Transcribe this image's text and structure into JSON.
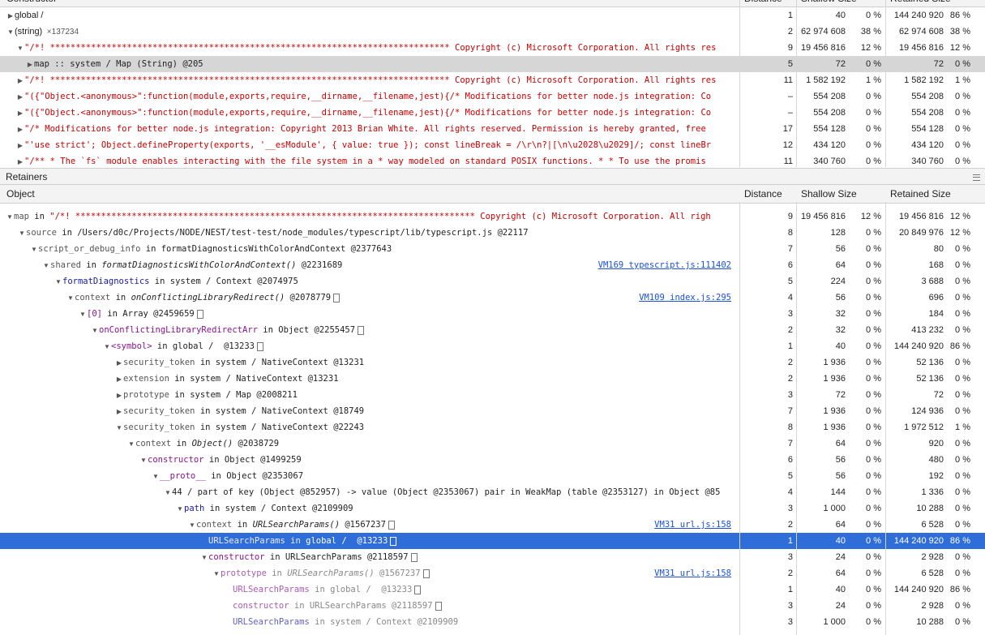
{
  "top_header": {
    "constructor": "Constructor",
    "distance": "Distance",
    "shallow": "Shallow Size",
    "retained": "Retained Size"
  },
  "top_rows": [
    {
      "indent": 0,
      "tri": "▶",
      "parts": [
        {
          "t": "global /",
          "c": ""
        }
      ],
      "dist": "1",
      "shv": "40",
      "shp": "0 %",
      "rtv": "144 240 920",
      "rtp": "86 %"
    },
    {
      "indent": 0,
      "tri": "▼",
      "parts": [
        {
          "t": "(string)",
          "c": ""
        },
        {
          "t": "  ×137234",
          "c": "grey small"
        }
      ],
      "dist": "2",
      "shv": "62 974 608",
      "shp": "38 %",
      "rtv": "62 974 608",
      "rtp": "38 %"
    },
    {
      "indent": 1,
      "tri": "▼",
      "parts": [
        {
          "t": "\"/*! ****************************************************************************** Copyright (c) Microsoft Corporation. All rights res",
          "c": "red mono"
        }
      ],
      "dist": "9",
      "shv": "19 456 816",
      "shp": "12 %",
      "rtv": "19 456 816",
      "rtp": "12 %"
    },
    {
      "indent": 2,
      "tri": "▶",
      "parts": [
        {
          "t": "map :: system / Map (String) @205",
          "c": "mono"
        }
      ],
      "dist": "5",
      "shv": "72",
      "shp": "0 %",
      "rtv": "72",
      "rtp": "0 %",
      "sel": "grey"
    },
    {
      "indent": 1,
      "tri": "▶",
      "parts": [
        {
          "t": "\"/*! ****************************************************************************** Copyright (c) Microsoft Corporation. All rights res",
          "c": "red mono"
        }
      ],
      "dist": "11",
      "shv": "1 582 192",
      "shp": "1 %",
      "rtv": "1 582 192",
      "rtp": "1 %"
    },
    {
      "indent": 1,
      "tri": "▶",
      "parts": [
        {
          "t": "\"({\"Object.<anonymous>\":function(module,exports,require,__dirname,__filename,jest){/* Modifications for better node.js integration: Co",
          "c": "red mono"
        }
      ],
      "dist": "–",
      "shv": "554 208",
      "shp": "0 %",
      "rtv": "554 208",
      "rtp": "0 %"
    },
    {
      "indent": 1,
      "tri": "▶",
      "parts": [
        {
          "t": "\"({\"Object.<anonymous>\":function(module,exports,require,__dirname,__filename,jest){/* Modifications for better node.js integration: Co",
          "c": "red mono"
        }
      ],
      "dist": "–",
      "shv": "554 208",
      "shp": "0 %",
      "rtv": "554 208",
      "rtp": "0 %"
    },
    {
      "indent": 1,
      "tri": "▶",
      "parts": [
        {
          "t": "\"/* Modifications for better node.js integration: Copyright 2013 Brian White. All rights reserved. Permission is hereby granted, free",
          "c": "red mono"
        }
      ],
      "dist": "17",
      "shv": "554 128",
      "shp": "0 %",
      "rtv": "554 128",
      "rtp": "0 %"
    },
    {
      "indent": 1,
      "tri": "▶",
      "parts": [
        {
          "t": "\"'use strict'; Object.defineProperty(exports, '__esModule', { value: true }); const lineBreak = /\\r\\n?|[\\n\\u2028\\u2029]/; const lineBr",
          "c": "red mono"
        }
      ],
      "dist": "12",
      "shv": "434 120",
      "shp": "0 %",
      "rtv": "434 120",
      "rtp": "0 %"
    },
    {
      "indent": 1,
      "tri": "▶",
      "parts": [
        {
          "t": "\"/** * The `fs` module enables interacting with the file system in a * way modeled on standard POSIX functions. * * To use the promis",
          "c": "red mono"
        }
      ],
      "dist": "11",
      "shv": "340 760",
      "shp": "0 %",
      "rtv": "340 760",
      "rtp": "0 %"
    }
  ],
  "retainers_title": "Retainers",
  "bottom_header": {
    "object": "Object",
    "distance": "Distance",
    "shallow": "Shallow Size",
    "retained": "Retained Size"
  },
  "bottom_rows": [
    {
      "indent": 0,
      "tri": "▼",
      "parts": [
        {
          "t": "map",
          "c": "grey mono"
        },
        {
          "t": " in ",
          "c": "mono"
        },
        {
          "t": "\"/*! ****************************************************************************** Copyright (c) Microsoft Corporation. All righ",
          "c": "red mono"
        }
      ],
      "dist": "9",
      "shv": "19 456 816",
      "shp": "12 %",
      "rtv": "19 456 816",
      "rtp": "12 %"
    },
    {
      "indent": 1,
      "tri": "▼",
      "parts": [
        {
          "t": "source",
          "c": "grey mono"
        },
        {
          "t": " in /Users/d0c/Projects/NODE/NEST/test-test/node_modules/typescript/lib/typescript.js @22117",
          "c": "mono"
        }
      ],
      "dist": "8",
      "shv": "128",
      "shp": "0 %",
      "rtv": "20 849 976",
      "rtp": "12 %"
    },
    {
      "indent": 2,
      "tri": "▼",
      "parts": [
        {
          "t": "script_or_debug_info",
          "c": "grey mono"
        },
        {
          "t": " in formatDiagnosticsWithColorAndContext @2377643",
          "c": "mono"
        }
      ],
      "dist": "7",
      "shv": "56",
      "shp": "0 %",
      "rtv": "80",
      "rtp": "0 %"
    },
    {
      "indent": 3,
      "tri": "▼",
      "parts": [
        {
          "t": "shared",
          "c": "grey mono"
        },
        {
          "t": " in ",
          "c": "mono"
        },
        {
          "t": "formatDiagnosticsWithColorAndContext()",
          "c": "mono italic"
        },
        {
          "t": " @2231689",
          "c": "mono"
        }
      ],
      "link": "VM169 typescript.js:111402",
      "dist": "6",
      "shv": "64",
      "shp": "0 %",
      "rtv": "168",
      "rtp": "0 %"
    },
    {
      "indent": 4,
      "tri": "▼",
      "parts": [
        {
          "t": "formatDiagnostics",
          "c": "blue mono"
        },
        {
          "t": " in system / Context @2074975",
          "c": "mono"
        }
      ],
      "dist": "5",
      "shv": "224",
      "shp": "0 %",
      "rtv": "3 688",
      "rtp": "0 %"
    },
    {
      "indent": 5,
      "tri": "▼",
      "parts": [
        {
          "t": "context",
          "c": "grey mono"
        },
        {
          "t": " in ",
          "c": "mono"
        },
        {
          "t": "onConflictingLibraryRedirect()",
          "c": "mono italic"
        },
        {
          "t": " @2078779",
          "c": "mono"
        }
      ],
      "box": true,
      "link": "VM109 index.js:295",
      "dist": "4",
      "shv": "56",
      "shp": "0 %",
      "rtv": "696",
      "rtp": "0 %"
    },
    {
      "indent": 6,
      "tri": "▼",
      "parts": [
        {
          "t": "[0]",
          "c": "purple mono"
        },
        {
          "t": " in Array @2459659",
          "c": "mono"
        }
      ],
      "box": true,
      "dist": "3",
      "shv": "32",
      "shp": "0 %",
      "rtv": "184",
      "rtp": "0 %"
    },
    {
      "indent": 7,
      "tri": "▼",
      "parts": [
        {
          "t": "onConflictingLibraryRedirectArr",
          "c": "purple mono"
        },
        {
          "t": " in Object @2255457",
          "c": "mono"
        }
      ],
      "box": true,
      "dist": "2",
      "shv": "32",
      "shp": "0 %",
      "rtv": "413 232",
      "rtp": "0 %"
    },
    {
      "indent": 8,
      "tri": "▼",
      "parts": [
        {
          "t": "<symbol>",
          "c": "purple mono"
        },
        {
          "t": " in global /  @13233",
          "c": "mono"
        }
      ],
      "box": true,
      "dist": "1",
      "shv": "40",
      "shp": "0 %",
      "rtv": "144 240 920",
      "rtp": "86 %"
    },
    {
      "indent": 9,
      "tri": "▶",
      "parts": [
        {
          "t": "security_token",
          "c": "grey mono"
        },
        {
          "t": " in system / NativeContext @13231",
          "c": "mono"
        }
      ],
      "dist": "2",
      "shv": "1 936",
      "shp": "0 %",
      "rtv": "52 136",
      "rtp": "0 %"
    },
    {
      "indent": 9,
      "tri": "▶",
      "parts": [
        {
          "t": "extension",
          "c": "grey mono"
        },
        {
          "t": " in system / NativeContext @13231",
          "c": "mono"
        }
      ],
      "dist": "2",
      "shv": "1 936",
      "shp": "0 %",
      "rtv": "52 136",
      "rtp": "0 %"
    },
    {
      "indent": 9,
      "tri": "▶",
      "parts": [
        {
          "t": "prototype",
          "c": "grey mono"
        },
        {
          "t": " in system / Map @2008211",
          "c": "mono"
        }
      ],
      "dist": "3",
      "shv": "72",
      "shp": "0 %",
      "rtv": "72",
      "rtp": "0 %"
    },
    {
      "indent": 9,
      "tri": "▶",
      "parts": [
        {
          "t": "security_token",
          "c": "grey mono"
        },
        {
          "t": " in system / NativeContext @18749",
          "c": "mono"
        }
      ],
      "dist": "7",
      "shv": "1 936",
      "shp": "0 %",
      "rtv": "124 936",
      "rtp": "0 %"
    },
    {
      "indent": 9,
      "tri": "▼",
      "parts": [
        {
          "t": "security_token",
          "c": "grey mono"
        },
        {
          "t": " in system / NativeContext @22243",
          "c": "mono"
        }
      ],
      "dist": "8",
      "shv": "1 936",
      "shp": "0 %",
      "rtv": "1 972 512",
      "rtp": "1 %"
    },
    {
      "indent": 10,
      "tri": "▼",
      "parts": [
        {
          "t": "context",
          "c": "grey mono"
        },
        {
          "t": " in ",
          "c": "mono"
        },
        {
          "t": "Object()",
          "c": "mono italic"
        },
        {
          "t": " @2038729",
          "c": "mono"
        }
      ],
      "dist": "7",
      "shv": "64",
      "shp": "0 %",
      "rtv": "920",
      "rtp": "0 %"
    },
    {
      "indent": 11,
      "tri": "▼",
      "parts": [
        {
          "t": "constructor",
          "c": "purple mono"
        },
        {
          "t": " in Object @1499259",
          "c": "mono"
        }
      ],
      "dist": "6",
      "shv": "56",
      "shp": "0 %",
      "rtv": "480",
      "rtp": "0 %"
    },
    {
      "indent": 12,
      "tri": "▼",
      "parts": [
        {
          "t": "__proto__",
          "c": "purple mono"
        },
        {
          "t": " in Object @2353067",
          "c": "mono"
        }
      ],
      "dist": "5",
      "shv": "56",
      "shp": "0 %",
      "rtv": "192",
      "rtp": "0 %"
    },
    {
      "indent": 13,
      "tri": "▼",
      "parts": [
        {
          "t": "44 / part of key (Object @852957) -> value (Object @2353067) pair in WeakMap (table @2353127) in Object @85",
          "c": "mono"
        }
      ],
      "dist": "4",
      "shv": "144",
      "shp": "0 %",
      "rtv": "1 336",
      "rtp": "0 %"
    },
    {
      "indent": 14,
      "tri": "▼",
      "parts": [
        {
          "t": "path",
          "c": "blue mono"
        },
        {
          "t": " in system / Context @2109909",
          "c": "mono"
        }
      ],
      "dist": "3",
      "shv": "1 000",
      "shp": "0 %",
      "rtv": "10 288",
      "rtp": "0 %"
    },
    {
      "indent": 15,
      "tri": "▼",
      "parts": [
        {
          "t": "context",
          "c": "grey mono"
        },
        {
          "t": " in ",
          "c": "mono"
        },
        {
          "t": "URLSearchParams()",
          "c": "mono italic"
        },
        {
          "t": " @1567237",
          "c": "mono"
        }
      ],
      "box": true,
      "link": "VM31 url.js:158",
      "dist": "2",
      "shv": "64",
      "shp": "0 %",
      "rtv": "6 528",
      "rtp": "0 %"
    },
    {
      "indent": 16,
      "tri": "",
      "parts": [
        {
          "t": "URLSearchParams",
          "c": "purple mono"
        },
        {
          "t": " in ",
          "c": "grey mono"
        },
        {
          "t": "global /  @13233",
          "c": "mono"
        }
      ],
      "box": true,
      "dist": "1",
      "shv": "40",
      "shp": "0 %",
      "rtv": "144 240 920",
      "rtp": "86 %",
      "sel": "blue"
    },
    {
      "indent": 16,
      "tri": "▼",
      "parts": [
        {
          "t": "constructor",
          "c": "purple mono"
        },
        {
          "t": " in URLSearchParams @2118597",
          "c": "mono"
        }
      ],
      "box": true,
      "dist": "3",
      "shv": "24",
      "shp": "0 %",
      "rtv": "2 928",
      "rtp": "0 %"
    },
    {
      "indent": 17,
      "tri": "▼",
      "parts": [
        {
          "t": "prototype",
          "c": "purple mono dimtext"
        },
        {
          "t": " in ",
          "c": "dim mono"
        },
        {
          "t": "URLSearchParams()",
          "c": "dim mono italic"
        },
        {
          "t": " @1567237",
          "c": "dim mono"
        }
      ],
      "box": true,
      "link": "VM31 url.js:158",
      "dist": "2",
      "shv": "64",
      "shp": "0 %",
      "rtv": "6 528",
      "rtp": "0 %"
    },
    {
      "indent": 18,
      "tri": "",
      "parts": [
        {
          "t": "URLSearchParams",
          "c": "purple mono dimtext"
        },
        {
          "t": " in ",
          "c": "dim mono"
        },
        {
          "t": "global /  @13233",
          "c": "dim mono"
        }
      ],
      "box": true,
      "dist": "1",
      "shv": "40",
      "shp": "0 %",
      "rtv": "144 240 920",
      "rtp": "86 %"
    },
    {
      "indent": 18,
      "tri": "",
      "parts": [
        {
          "t": "constructor",
          "c": "purple mono dimtext"
        },
        {
          "t": " in ",
          "c": "dim mono"
        },
        {
          "t": "URLSearchParams @2118597",
          "c": "dim mono"
        }
      ],
      "box": true,
      "dist": "3",
      "shv": "24",
      "shp": "0 %",
      "rtv": "2 928",
      "rtp": "0 %"
    },
    {
      "indent": 18,
      "tri": "",
      "parts": [
        {
          "t": "URLSearchParams",
          "c": "blue mono dimtext"
        },
        {
          "t": " in ",
          "c": "dim mono"
        },
        {
          "t": "system / Context @2109909",
          "c": "dim mono"
        }
      ],
      "dist": "3",
      "shv": "1 000",
      "shp": "0 %",
      "rtv": "10 288",
      "rtp": "0 %"
    }
  ]
}
